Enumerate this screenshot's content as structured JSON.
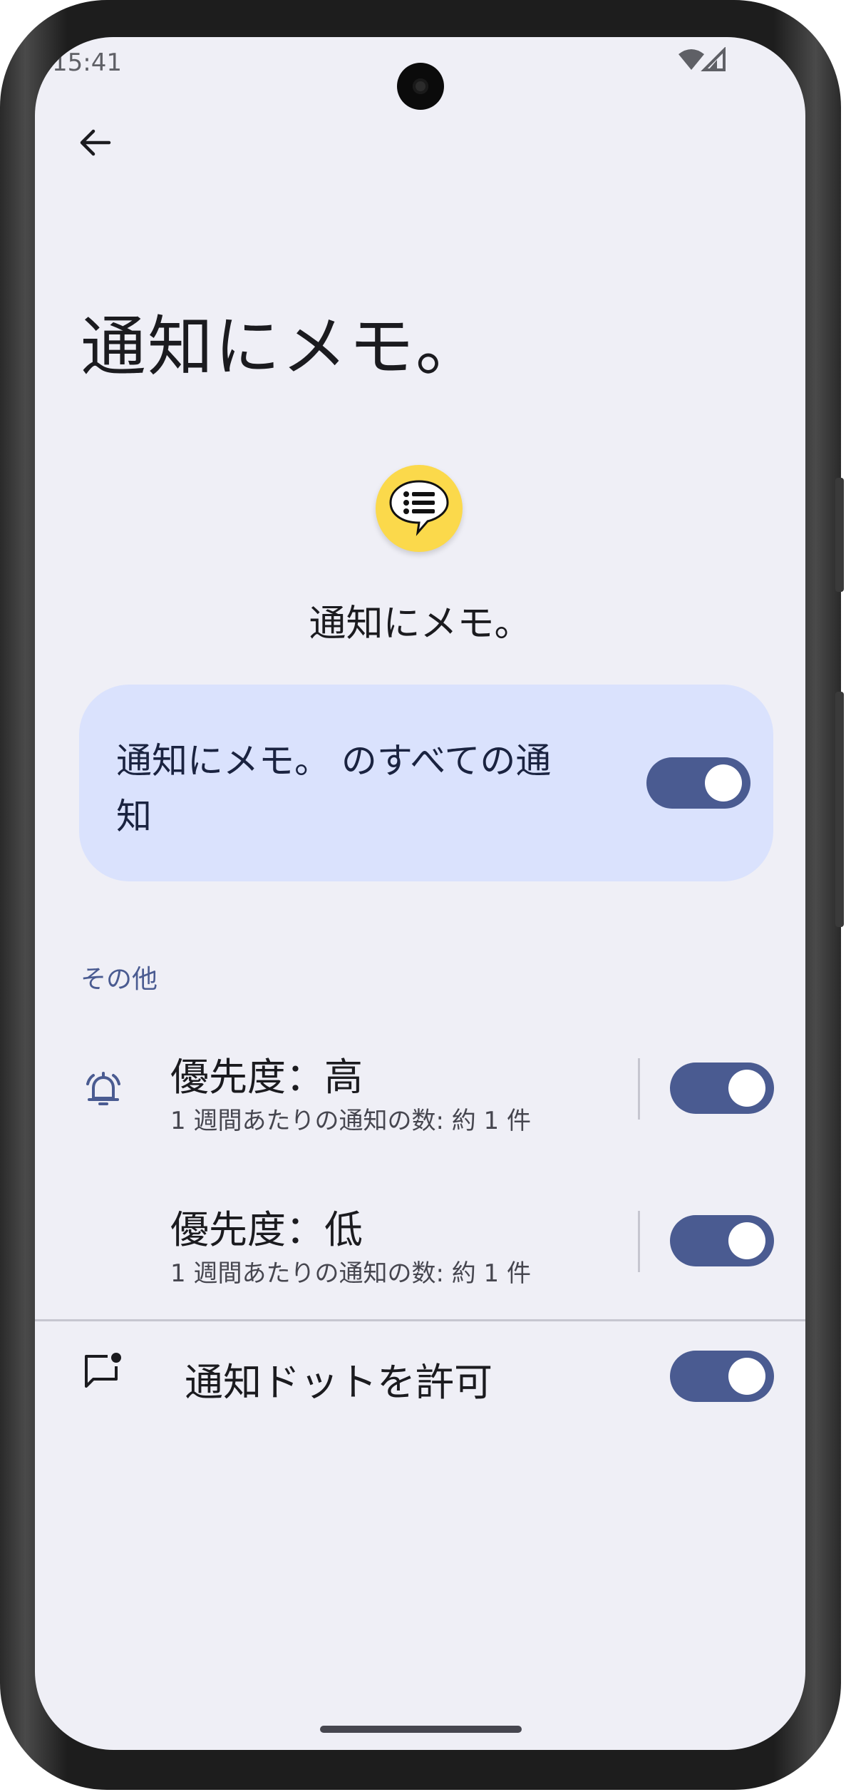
{
  "status_bar": {
    "time": "15:41"
  },
  "page_title": "通知にメモ。",
  "app": {
    "name": "通知にメモ。",
    "icon": "list-bubble-icon",
    "icon_color": "#fbd94b"
  },
  "master_toggle": {
    "label": "通知にメモ。 のすべての通知",
    "enabled": true
  },
  "section_header": "その他",
  "channels": [
    {
      "title": "優先度：高",
      "subtitle": "1 週間あたりの通知の数: 約 1 件",
      "enabled": true,
      "icon": "bell-icon"
    },
    {
      "title": "優先度：低",
      "subtitle": "1 週間あたりの通知の数: 約 1 件",
      "enabled": true
    }
  ],
  "dots": {
    "label": "通知ドットを許可",
    "enabled": true,
    "icon": "notification-dot-icon"
  },
  "colors": {
    "accent": "#4a5b91",
    "card": "#dae2fd",
    "background": "#efeff6"
  }
}
